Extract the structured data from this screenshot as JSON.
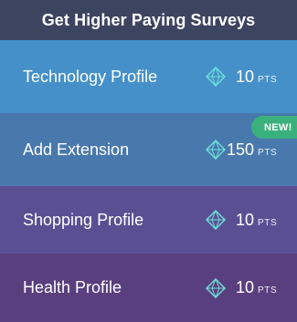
{
  "header": {
    "title": "Get Higher Paying Surveys"
  },
  "rows": [
    {
      "label": "Technology Profile",
      "points": "10",
      "unit": "PTS"
    },
    {
      "label": "Add Extension",
      "points": "150",
      "unit": "PTS",
      "badge": "NEW!"
    },
    {
      "label": "Shopping Profile",
      "points": "10",
      "unit": "PTS"
    },
    {
      "label": "Health Profile",
      "points": "10",
      "unit": "PTS"
    }
  ],
  "icons": {
    "points": "diamond-icon"
  },
  "colors": {
    "header": "#3d4460",
    "row_technology": "#4590c9",
    "row_extension": "#4878ac",
    "row_shopping": "#5a4f93",
    "row_health": "#5a3f7e",
    "badge": "#3ab17d",
    "gem": "#6fe0d8"
  }
}
